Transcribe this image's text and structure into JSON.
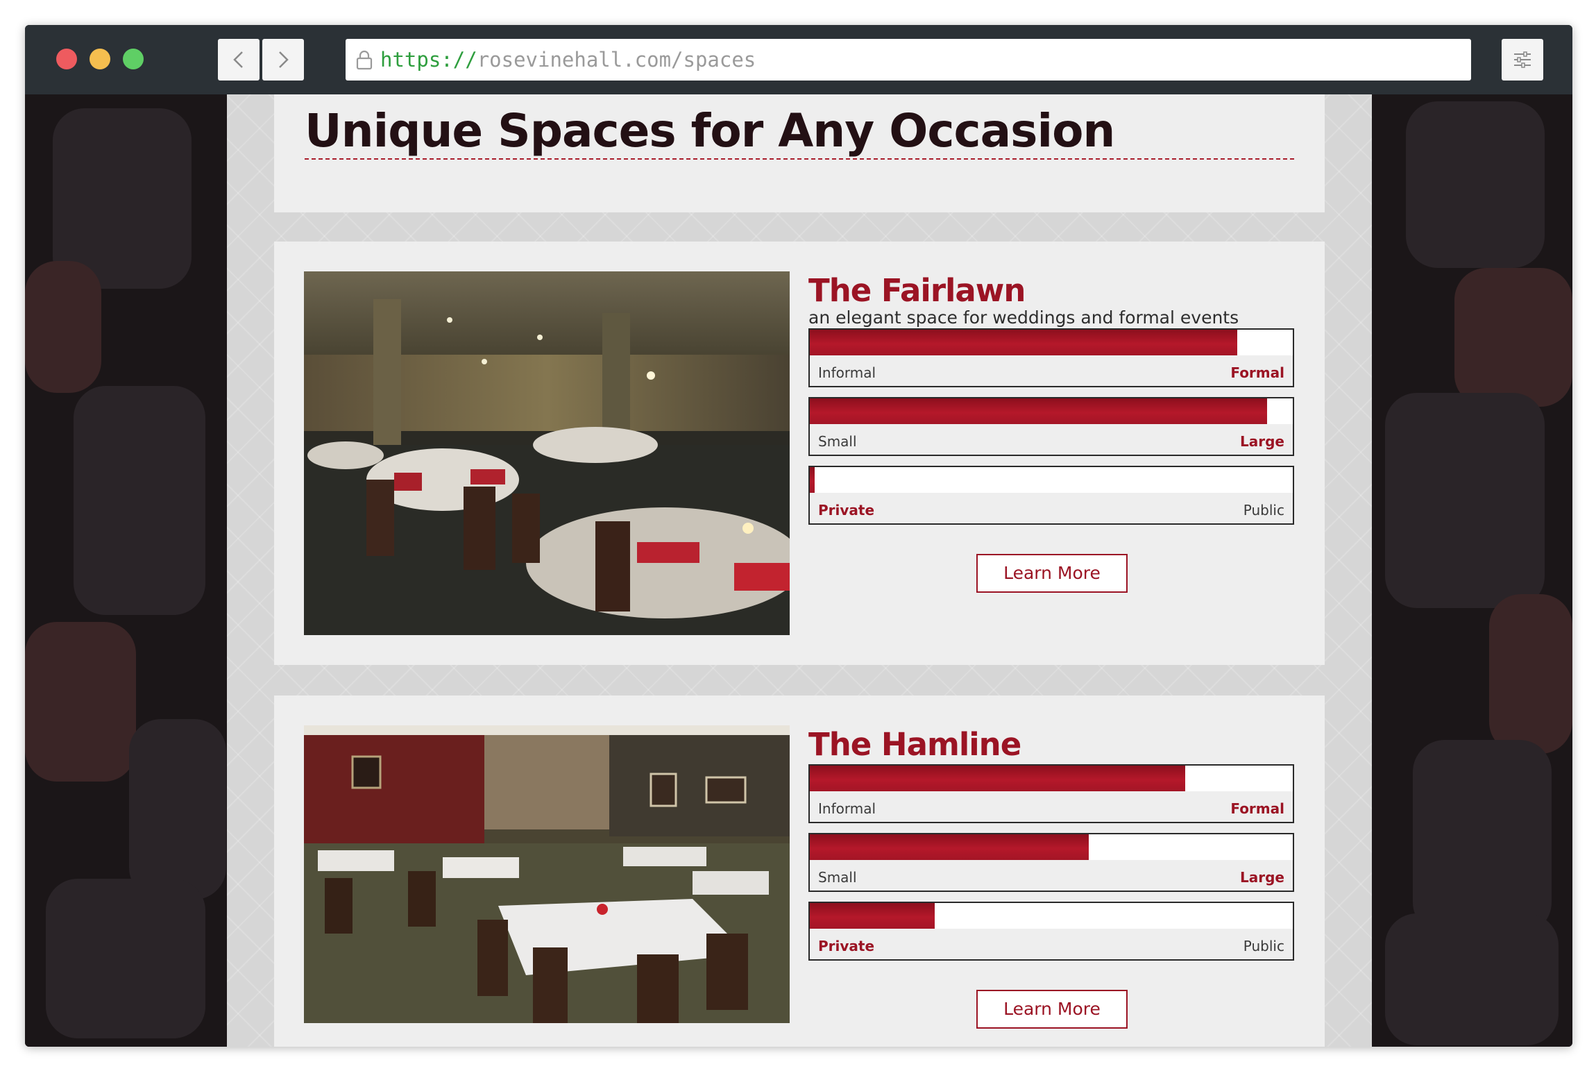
{
  "browser": {
    "url_scheme": "https://",
    "url_rest": "rosevinehall.com/spaces",
    "traffic_lights": {
      "close": "#ee5b5f",
      "minimize": "#f5be4f",
      "maximize": "#5fcf65"
    }
  },
  "page": {
    "title": "Unique Spaces for Any Occasion",
    "accent_color": "#9b1424"
  },
  "spaces": [
    {
      "name": "The Fairlawn",
      "description": "an elegant space for weddings and formal events",
      "button_label": "Learn More",
      "meters": [
        {
          "low_label": "Informal",
          "high_label": "Formal",
          "value": 0.885,
          "emphasis": "high"
        },
        {
          "low_label": "Small",
          "high_label": "Large",
          "value": 0.947,
          "emphasis": "high"
        },
        {
          "low_label": "Private",
          "high_label": "Public",
          "value": 0.01,
          "emphasis": "low"
        }
      ]
    },
    {
      "name": "The Hamline",
      "description": "",
      "button_label": "Learn More",
      "meters": [
        {
          "low_label": "Informal",
          "high_label": "Formal",
          "value": 0.778,
          "emphasis": "high"
        },
        {
          "low_label": "Small",
          "high_label": "Large",
          "value": 0.578,
          "emphasis": "high"
        },
        {
          "low_label": "Private",
          "high_label": "Public",
          "value": 0.258,
          "emphasis": "low"
        }
      ]
    }
  ]
}
